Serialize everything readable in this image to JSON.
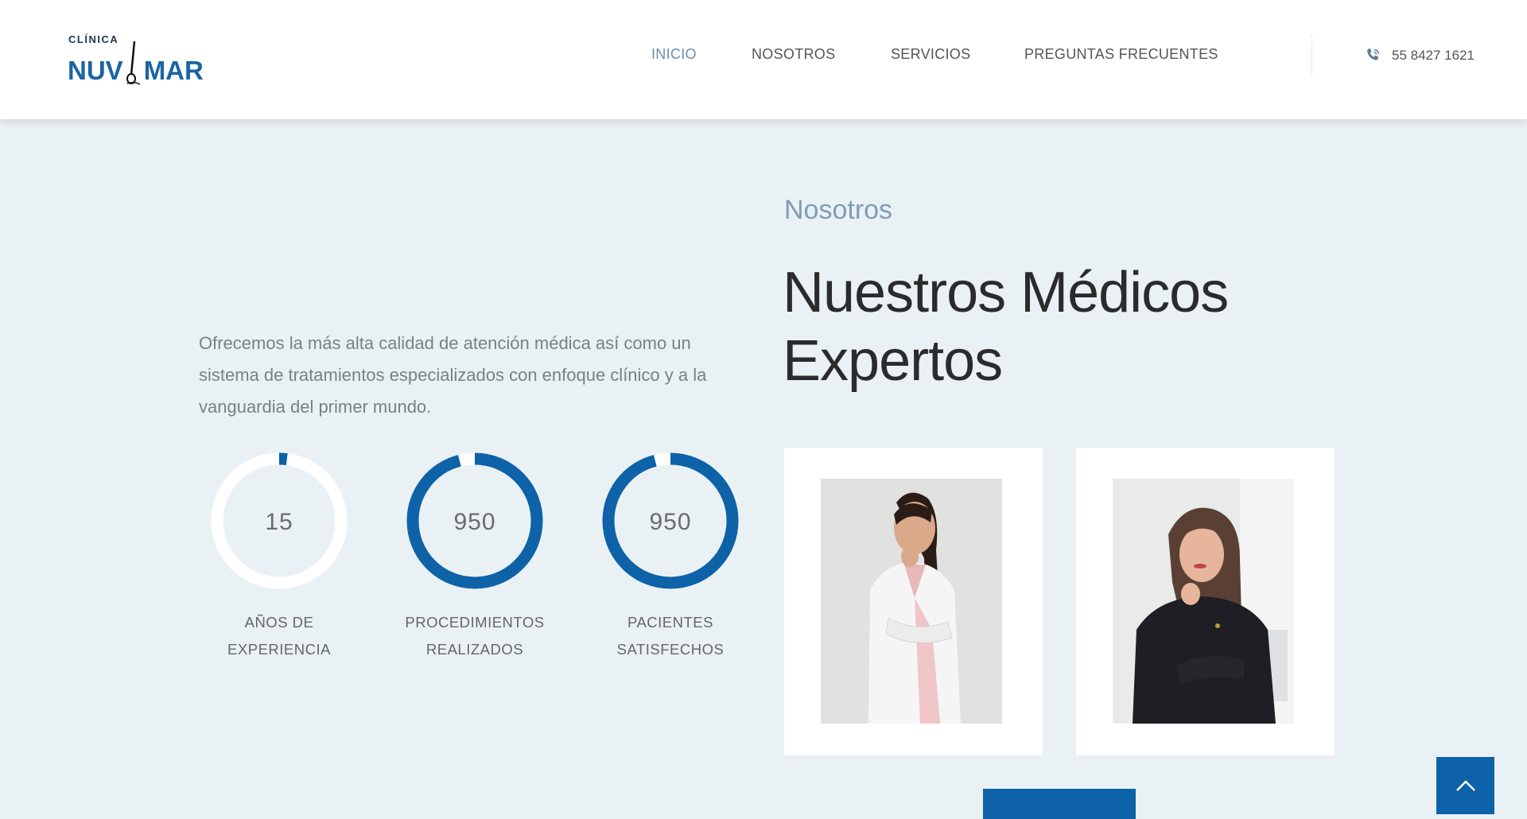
{
  "brand": {
    "small": "CLÍNICA",
    "name_left": "NUV",
    "name_right": "MAR",
    "primary_color": "#1a64a3"
  },
  "nav": {
    "items": [
      {
        "label": "INICIO",
        "active": true
      },
      {
        "label": "NOSOTROS",
        "active": false
      },
      {
        "label": "SERVICIOS",
        "active": false
      },
      {
        "label": "PREGUNTAS FRECUENTES",
        "active": false
      }
    ],
    "phone": "55 8427 1621",
    "phone_icon": "phone-icon"
  },
  "about": {
    "intro": "Ofrecemos la más alta calidad de atención médica así como un sistema de tratamientos especializados con enfoque clínico y a la vanguardia del primer mundo.",
    "eyebrow": "Nosotros",
    "heading": "Nuestros Médicos Expertos"
  },
  "stats": [
    {
      "value": "15",
      "label": "AÑOS DE\nEXPERIENCIA",
      "progress": 0.02
    },
    {
      "value": "950",
      "label": "PROCEDIMIENTOS\nREALIZADOS",
      "progress": 0.96
    },
    {
      "value": "950",
      "label": "PACIENTES\nSATISFECHOS",
      "progress": 0.96
    }
  ],
  "colors": {
    "accent": "#0d62a8",
    "ring_track": "#ffffff",
    "background": "#eaf1f5"
  },
  "doctors": [
    {
      "photo_alt": "doctor-photo-1"
    },
    {
      "photo_alt": "doctor-photo-2"
    }
  ],
  "scroll_top_icon": "chevron-up-icon"
}
